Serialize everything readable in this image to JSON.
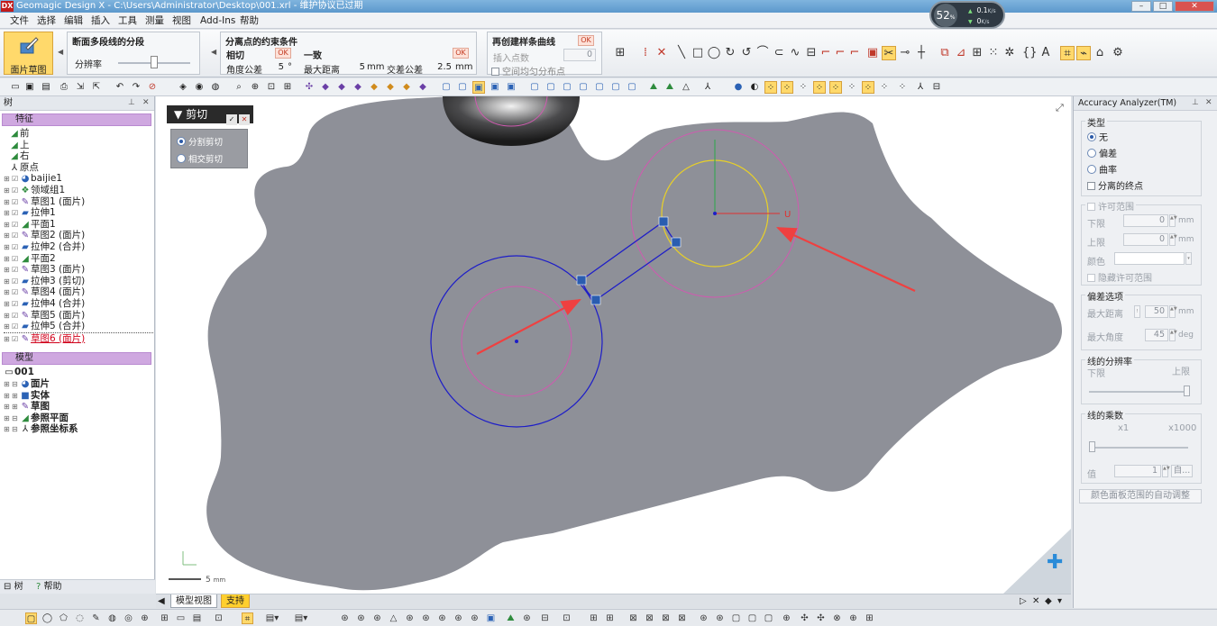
{
  "window": {
    "app_logo": "DX",
    "title": "Geomagic Design X - C:\\Users\\Administrator\\Desktop\\001.xrl - 维护协议已过期",
    "minimize": "–",
    "maximize": "□",
    "close": "✕"
  },
  "menu": [
    "文件",
    "选择",
    "编辑",
    "插入",
    "工具",
    "测量",
    "视图",
    "Add-Ins",
    "帮助"
  ],
  "speed_meter": {
    "percent": "52",
    "percent_unit": "%",
    "upload": "0.1",
    "download": "0",
    "unit": "K/s"
  },
  "ribbon": {
    "face_sketch_label": "面片草图",
    "segment_group": {
      "title": "断面多段线的分段",
      "resolution_label": "分辨率",
      "resolution_level": 0.5
    },
    "constraint_group": {
      "title": "分离点的约束条件",
      "tangent_label": "相切",
      "ok": "OK",
      "angle_tol_label": "角度公差",
      "angle_tol_value": "5",
      "angle_tol_unit": "°",
      "coincident_label": "一致",
      "max_dist_label": "最大距离",
      "max_dist_value": "5",
      "max_dist_unit": "mm",
      "cross_tol_label": "交差公差",
      "cross_tol_value": "2.5",
      "cross_tol_unit": "mm"
    },
    "spline_group": {
      "title": "再创建样条曲线",
      "ok": "OK",
      "insert_points_label": "插入点数",
      "insert_points_value": "0",
      "uniform_label": "空间均匀分布点"
    }
  },
  "tree_panel": {
    "header": "树",
    "pin": "⊥",
    "close": "✕",
    "features_section": "特征",
    "features": [
      {
        "label": "前",
        "icon": "plane-icon"
      },
      {
        "label": "上",
        "icon": "plane-icon"
      },
      {
        "label": "右",
        "icon": "plane-icon"
      },
      {
        "label": "原点",
        "icon": "origin-icon"
      },
      {
        "label": "baijie1",
        "icon": "mesh-icon"
      },
      {
        "label": "领域组1",
        "icon": "region-group-icon"
      },
      {
        "label": "草图1 (面片)",
        "icon": "sketch-icon"
      },
      {
        "label": "拉伸1",
        "icon": "extrude-icon"
      },
      {
        "label": "平面1",
        "icon": "plane-icon"
      },
      {
        "label": "草图2 (面片)",
        "icon": "sketch-icon"
      },
      {
        "label": "拉伸2 (合并)",
        "icon": "extrude-icon"
      },
      {
        "label": "平面2",
        "icon": "plane-icon"
      },
      {
        "label": "草图3 (面片)",
        "icon": "sketch-icon"
      },
      {
        "label": "拉伸3 (剪切)",
        "icon": "extrude-icon"
      },
      {
        "label": "草图4 (面片)",
        "icon": "sketch-icon"
      },
      {
        "label": "拉伸4 (合并)",
        "icon": "extrude-icon"
      },
      {
        "label": "草图5 (面片)",
        "icon": "sketch-icon"
      },
      {
        "label": "拉伸5 (合并)",
        "icon": "extrude-icon"
      },
      {
        "label": "草图6 (面片)",
        "icon": "sketch-icon"
      }
    ],
    "model_section": "模型",
    "model_root": "001",
    "model_items": [
      {
        "label": "面片",
        "icon": "mesh-icon"
      },
      {
        "label": "实体",
        "icon": "solid-icon"
      },
      {
        "label": "草图",
        "icon": "sketch-icon"
      },
      {
        "label": "参照平面",
        "icon": "plane-icon"
      },
      {
        "label": "参照坐标系",
        "icon": "coordinate-system-icon"
      }
    ],
    "bottom_tabs": [
      "树",
      "帮助"
    ]
  },
  "viewport": {
    "cut_panel_title": "剪切",
    "cut_options": [
      "分割剪切",
      "相交剪切"
    ],
    "cut_selected": 0,
    "axis_label": "U",
    "scale_label": "5",
    "scale_unit": "mm",
    "colors": {
      "background": "#ffffff",
      "part": "#8e9098",
      "sketch_blue": "#1d1dc8",
      "mesh_pink": "#d05ab0",
      "yellow_circle": "#e8d028",
      "arrow_red": "#ef4040"
    }
  },
  "view_tabs": [
    "模型视图",
    "支持"
  ],
  "accuracy_panel": {
    "title": "Accuracy Analyzer(TM)",
    "pin": "⊥",
    "close": "✕",
    "type_group": "类型",
    "type_options": [
      "无",
      "偏差",
      "曲率"
    ],
    "type_selected": 0,
    "separate_endpoints": "分离的终点",
    "tolerance_group": "许可范围",
    "lower_label": "下限",
    "upper_label": "上限",
    "lower_value": "0",
    "upper_value": "0",
    "tol_unit": "mm",
    "color_label": "颜色",
    "hide_tolerance": "隐藏许可范围",
    "deviation_group": "偏差选项",
    "max_distance_label": "最大距离",
    "max_distance_value": "50",
    "max_distance_unit": "mm",
    "max_angle_label": "最大角度",
    "max_angle_value": "45",
    "max_angle_unit": "deg",
    "resolution_group": "线的分辨率",
    "res_lower": "下限",
    "res_upper": "上限",
    "multiplier_group": "线的乘数",
    "mult_min": "x1",
    "mult_max": "x1000",
    "value_label": "值",
    "value": "1",
    "auto_button": "自...",
    "auto_adjust": "颜色面板范围的自动调整"
  }
}
